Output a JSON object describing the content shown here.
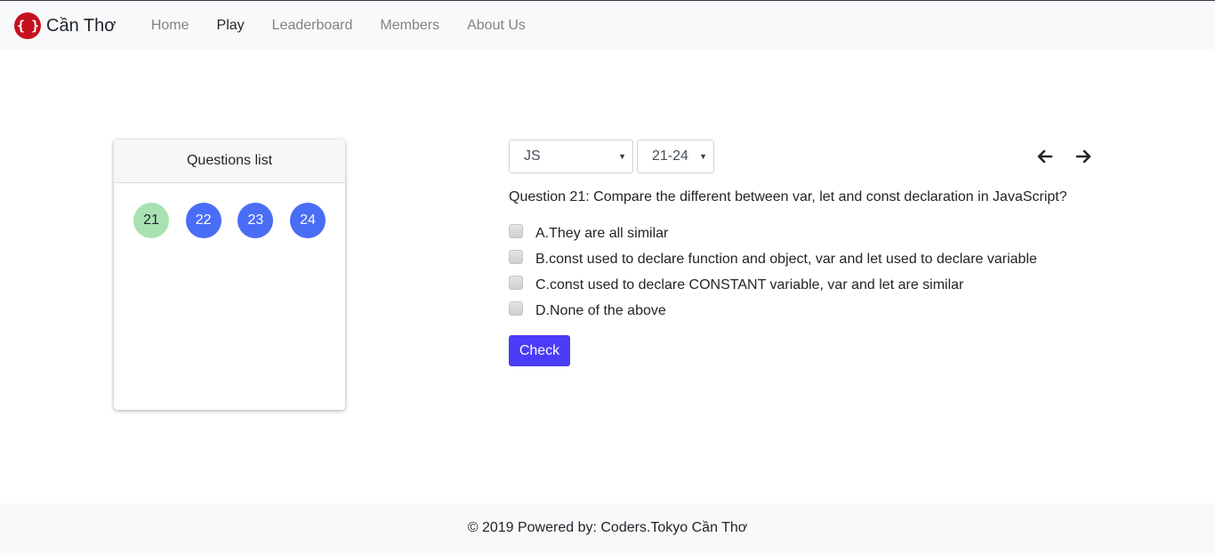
{
  "navbar": {
    "brand_logo_text": "{ }",
    "brand_name": "Cần Thơ",
    "links": [
      {
        "label": "Home"
      },
      {
        "label": "Play"
      },
      {
        "label": "Leaderboard"
      },
      {
        "label": "Members"
      },
      {
        "label": "About Us"
      }
    ],
    "active_link": "Play"
  },
  "questions_list": {
    "title": "Questions list",
    "items": [
      {
        "number": "21",
        "state": "current"
      },
      {
        "number": "22",
        "state": "pending"
      },
      {
        "number": "23",
        "state": "pending"
      },
      {
        "number": "24",
        "state": "pending"
      }
    ]
  },
  "controls": {
    "topic_select": {
      "selected": "JS"
    },
    "range_select": {
      "selected": "21-24"
    },
    "prev_icon": "arrow-left-icon",
    "next_icon": "arrow-right-icon"
  },
  "question": {
    "text": "Question 21: Compare the different between var, let and const declaration in JavaScript?",
    "options": [
      {
        "label": "A.They are all similar",
        "checked": false
      },
      {
        "label": "B.const used to declare function and object, var and let used to declare variable",
        "checked": false
      },
      {
        "label": "C.const used to declare CONSTANT variable, var and let are similar",
        "checked": false
      },
      {
        "label": "D.None of the above",
        "checked": false
      }
    ],
    "check_button_label": "Check"
  },
  "footer": {
    "text": "© 2019 Powered by: Coders.Tokyo Cần Thơ"
  },
  "colors": {
    "brand_red": "#c5111f",
    "question_pending": "#4a6df6",
    "question_current": "#a8e2b1",
    "check_button": "#4a3cf7",
    "navbar_bg": "#f8f9fa"
  }
}
